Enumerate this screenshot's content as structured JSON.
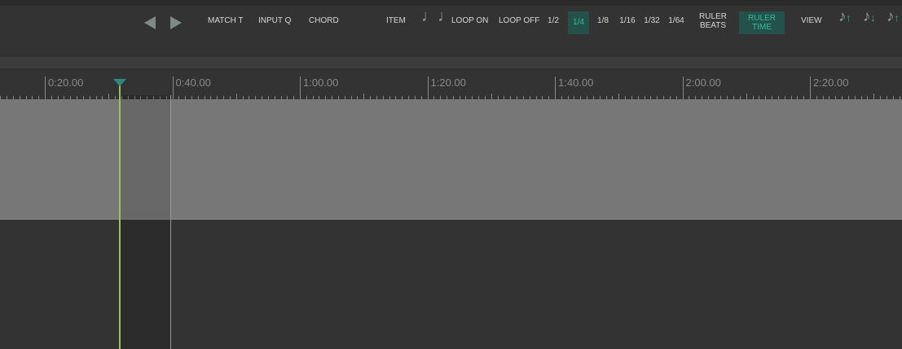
{
  "toolbar": {
    "match_t": "MATCH T",
    "input_q": "INPUT Q",
    "chord": "CHORD",
    "item": "ITEM",
    "loop_on": "LOOP ON",
    "loop_off": "LOOP OFF",
    "grid": [
      "1/2",
      "1/4",
      "1/8",
      "1/16",
      "1/32",
      "1/64"
    ],
    "grid_selected": "1/4",
    "ruler_beats_1": "RULER",
    "ruler_beats_2": "BEATS",
    "ruler_time_1": "RULER",
    "ruler_time_2": "TIME",
    "view": "VIEW",
    "accent": "#2fbf96"
  },
  "ruler": {
    "labels": [
      "0:20.00",
      "0:40.00",
      "1:00.00",
      "1:20.00",
      "1:40.00",
      "2:00.00",
      "2:20.00"
    ]
  }
}
